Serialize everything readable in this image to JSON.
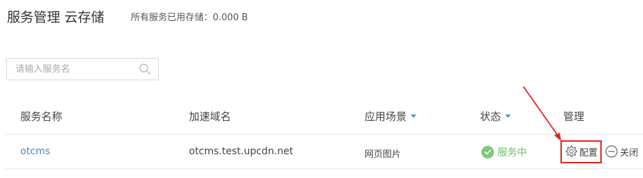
{
  "header": {
    "title": "服务管理 云存储",
    "storage_text": "所有服务已用存储：0.000 B"
  },
  "search": {
    "placeholder": "请输入服务名",
    "value": ""
  },
  "table": {
    "columns": {
      "name": "服务名称",
      "domain": "加速域名",
      "scene": "应用场景",
      "status": "状态",
      "manage": "管理"
    },
    "rows": [
      {
        "name": "otcms",
        "domain": "otcms.test.upcdn.net",
        "scene": "网页图片",
        "status": "服务中",
        "config_label": "配置",
        "close_label": "关闭"
      }
    ]
  },
  "colors": {
    "link": "#3d8fc4",
    "status_ok": "#6cbf6c",
    "highlight": "#e0261f",
    "sort_caret": "#3fa3c8"
  },
  "icons": {
    "search": "search-icon",
    "status": "check-circle-icon",
    "config": "gear-icon",
    "close": "minus-circle-icon",
    "sort": "caret-down-icon"
  }
}
